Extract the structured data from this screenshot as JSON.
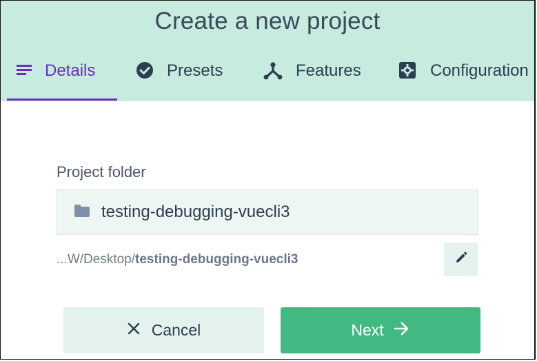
{
  "header": {
    "title": "Create a new project"
  },
  "tabs": [
    {
      "label": "Details",
      "icon": "list-icon",
      "active": true
    },
    {
      "label": "Presets",
      "icon": "check-circle-icon",
      "active": false
    },
    {
      "label": "Features",
      "icon": "fork-icon",
      "active": false
    },
    {
      "label": "Configuration",
      "icon": "gear-icon",
      "active": false
    }
  ],
  "form": {
    "folder_label": "Project folder",
    "folder_value": "testing-debugging-vuecli3",
    "folder_icon": "folder-icon",
    "path_prefix": "...W/Desktop/",
    "path_name": "testing-debugging-vuecli3",
    "edit_icon": "pencil-icon"
  },
  "actions": {
    "cancel_label": "Cancel",
    "next_label": "Next"
  },
  "colors": {
    "header_bg": "#c7ebde",
    "accent": "#6a2cc1",
    "primary": "#42b983"
  }
}
